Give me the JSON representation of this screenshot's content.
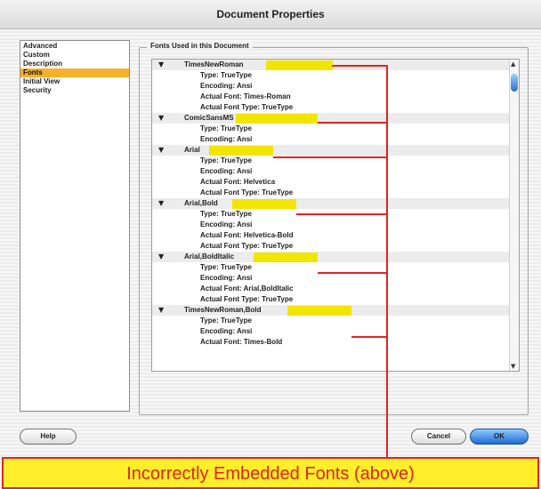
{
  "window": {
    "title": "Document Properties"
  },
  "sidebar": {
    "items": [
      "Advanced",
      "Custom",
      "Description",
      "Fonts",
      "Initial View",
      "Security"
    ],
    "selected_index": 3
  },
  "fonts_group": {
    "label": "Fonts Used in this Document"
  },
  "font_list": [
    {
      "name": "TimesNewRoman",
      "props": [
        "Type: TrueType",
        "Encoding: Ansi",
        "Actual Font: Times-Roman",
        "Actual Font Type: TrueType"
      ]
    },
    {
      "name": "ComicSansMS",
      "props": [
        "Type: TrueType",
        "Encoding: Ansi"
      ]
    },
    {
      "name": "Arial",
      "props": [
        "Type: TrueType",
        "Encoding: Ansi",
        "Actual Font: Helvetica",
        "Actual Font Type: TrueType"
      ]
    },
    {
      "name": "Arial,Bold",
      "props": [
        "Type: TrueType",
        "Encoding: Ansi",
        "Actual Font: Helvetica-Bold",
        "Actual Font Type: TrueType"
      ]
    },
    {
      "name": "Arial,BoldItalic",
      "props": [
        "Type: TrueType",
        "Encoding: Ansi",
        "Actual Font: Arial,BoldItalic",
        "Actual Font Type: TrueType"
      ]
    },
    {
      "name": "TimesNewRoman,Bold",
      "props": [
        "Type: TrueType",
        "Encoding: Ansi",
        "Actual Font: Times-Bold"
      ]
    }
  ],
  "buttons": {
    "help": "Help",
    "cancel": "Cancel",
    "ok": "OK"
  },
  "callout": {
    "text": "Incorrectly Embedded Fonts (above)"
  },
  "colors": {
    "selection": "#f7b02b",
    "highlight": "#f2e500",
    "callout_fill": "#ffef2b",
    "annotation_red": "#e02424",
    "ok_button": "#1e6bd4"
  },
  "icons": {
    "expand": "disclosure-triangle-icon",
    "scroll_up": "scroll-up-arrow-icon",
    "scroll_down": "scroll-down-arrow-icon"
  }
}
